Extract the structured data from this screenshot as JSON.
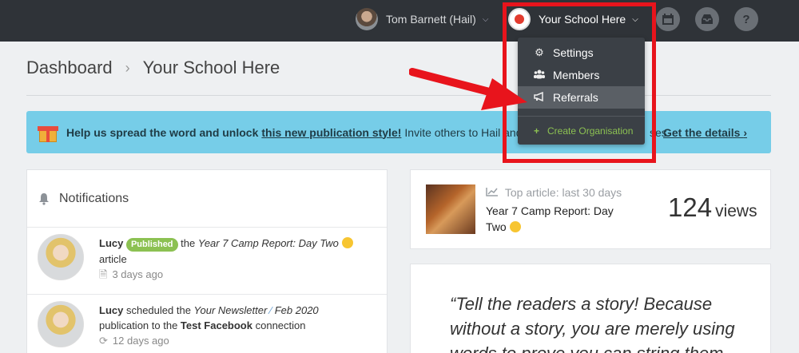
{
  "topbar": {
    "user_name": "Tom  Barnett (Hail)",
    "school_name": "Your School Here",
    "icons": [
      "calendar-icon",
      "inbox-icon",
      "help-icon"
    ],
    "help_glyph": "?"
  },
  "dropdown": {
    "items": [
      {
        "label": "Settings",
        "icon": "gear-icon"
      },
      {
        "label": "Members",
        "icon": "users-icon"
      },
      {
        "label": "Referrals",
        "icon": "megaphone-icon"
      }
    ],
    "create_label": "Create Organisation"
  },
  "breadcrumb": {
    "root": "Dashboard",
    "current": "Your School Here"
  },
  "banner": {
    "lead": "Help us spread the word and unlock",
    "link": "this new publication style!",
    "rest": "Invite others to Hail and rece",
    "tail": "ses.",
    "details": "Get the details",
    "details_arrow": "›"
  },
  "notifications": {
    "title": "Notifications",
    "items": [
      {
        "user": "Lucy",
        "badge": "Published",
        "pre": "the",
        "article": "Year 7 Camp Report: Day Two",
        "post": "article",
        "time": "3 days ago"
      },
      {
        "user": "Lucy",
        "action": "scheduled the",
        "article": "Your Newsletter",
        "article2": "Feb 2020",
        "mid": "publication to the",
        "target": "Test Facebook",
        "post": "connection",
        "time": "12 days ago"
      }
    ]
  },
  "top_article": {
    "label": "Top article: last 30 days",
    "title": "Year 7 Camp Report: Day Two",
    "views_count": "124",
    "views_label": "views"
  },
  "quote": {
    "text": "“Tell the readers a story! Because without a story, you are merely using words to prove you can string them"
  },
  "colors": {
    "topbar": "#2f3338",
    "banner": "#76cde8",
    "badge": "#8cc152",
    "highlight": "#e8141c"
  }
}
